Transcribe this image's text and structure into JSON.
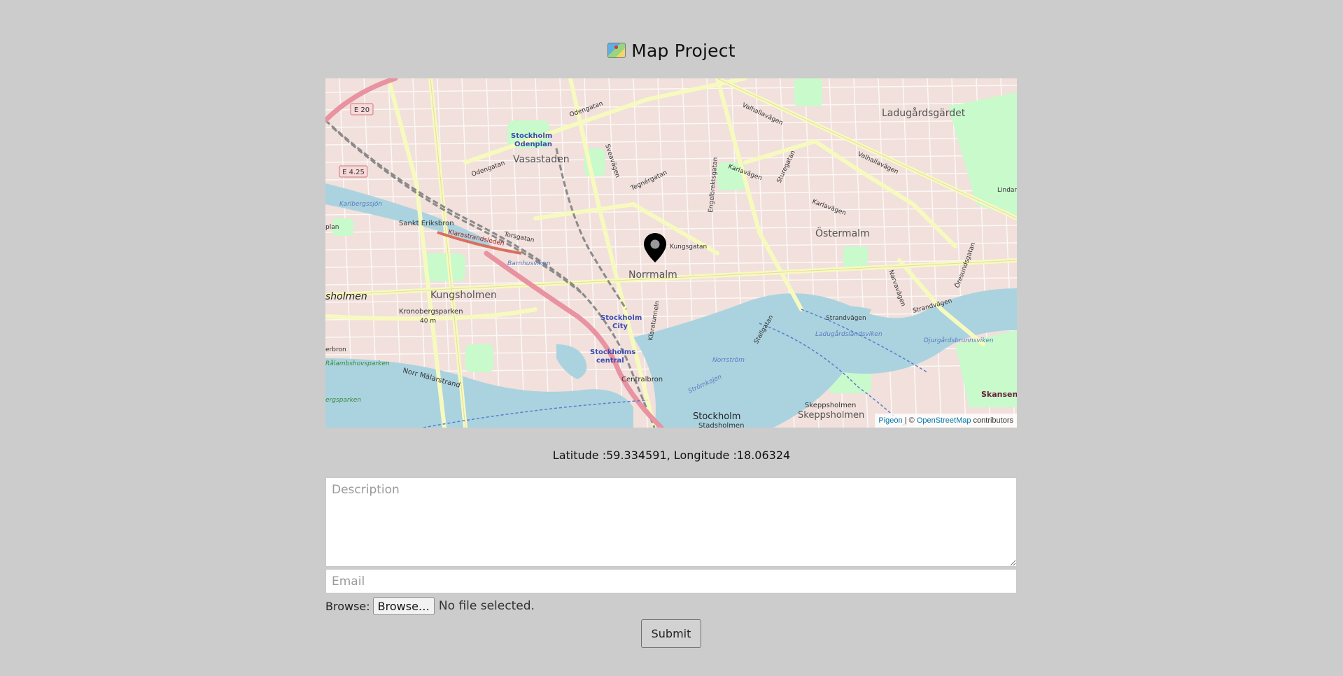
{
  "page": {
    "title": "Map Project",
    "title_icon": "world-map-icon"
  },
  "map": {
    "marker_icon": "map-pin-icon",
    "labels": {
      "ladugardsgardet": "Ladugårdsgärdet",
      "vasastaden": "Vasastaden",
      "odenplan_1": "Stockholm",
      "odenplan_2": "Odenplan",
      "ostermalm": "Östermalm",
      "norrmalm": "Norrmalm",
      "kungsholmen": "Kungsholmen",
      "kungsholmen_edge": "sholmen",
      "stockholm_city_1": "Stockholm",
      "stockholm_city_2": "City",
      "stockholms_central_1": "Stockholms",
      "stockholms_central_2": "central",
      "sankt_eriksbron": "Sankt Eriksbron",
      "klarastrandsleden": "Klarastrandsleden",
      "torsgatan": "Torsgatan",
      "kungsgatan": "Kungsgatan",
      "odengatan_1": "Odengatan",
      "odengatan_2": "Odengatan",
      "tegnergatan": "Tegnérgatan",
      "karlavagen_1": "Karlavägen",
      "karlavagen_2": "Karlavägen",
      "valhallavagen_1": "Valhallavägen",
      "valhallavagen_2": "Valhallavägen",
      "strandvagen_1": "Strandvägen",
      "strandvagen_2": "Strandvägen",
      "sturegatan": "Sturegatan",
      "engelbrektsgatan": "Engelbrektsgatan",
      "narvavagen": "Narvavägen",
      "sveavagen": "Sveavägen",
      "klaratunneln": "Klaratunneln",
      "stallgatan": "Stallgatan",
      "centralbron": "Centralbron",
      "norr_malarstrand": "Norr Mälarstrand",
      "kronobergsparken": "Kronobergsparken",
      "elev_40": "40 m",
      "barnhusviken": "Barnhusviken",
      "karlbergssjon": "Karlbergssjön",
      "norrstrom": "Norrström",
      "stromkajen": "Strömkajen",
      "ladugardslandsviken": "Ladugårdslandsviken",
      "djurgardsbrunnsviken": "Djurgårdsbrunnsviken",
      "skeppsholmen_1": "Skeppsholmen",
      "skeppsholmen_2": "Skeppsholmen",
      "stockholm": "Stockholm",
      "stadsholmen": "Stadsholmen",
      "skansen": "Skansen",
      "e20": "E 20",
      "e425": "E 4.25",
      "rlamsholmen": "Rålambshovsparken",
      "erbron": "erbron",
      "ergsparken": "ergsparken",
      "lindar": "Lindar",
      "oresundsgatan": "Öresundsgatan",
      "plan": "plan"
    },
    "attribution": {
      "leaflet_link": "Pigeon",
      "separator": " | © ",
      "osm_link": "OpenStreetMap",
      "suffix": " contributors"
    }
  },
  "coordinates": {
    "text": "Latitude :59.334591, Longitude :18.06324"
  },
  "form": {
    "description_placeholder": "Description",
    "email_placeholder": "Email",
    "file_label": "Browse:",
    "browse_button": "Browse…",
    "file_status": "No file selected.",
    "submit_button": "Submit"
  },
  "colors": {
    "background": "#cccccc",
    "water": "#aad3df",
    "park": "#c8facc",
    "urban": "#f2dad9",
    "major_road": "#f7fabf",
    "motorway": "#e892a2",
    "link": "#0078a8"
  }
}
